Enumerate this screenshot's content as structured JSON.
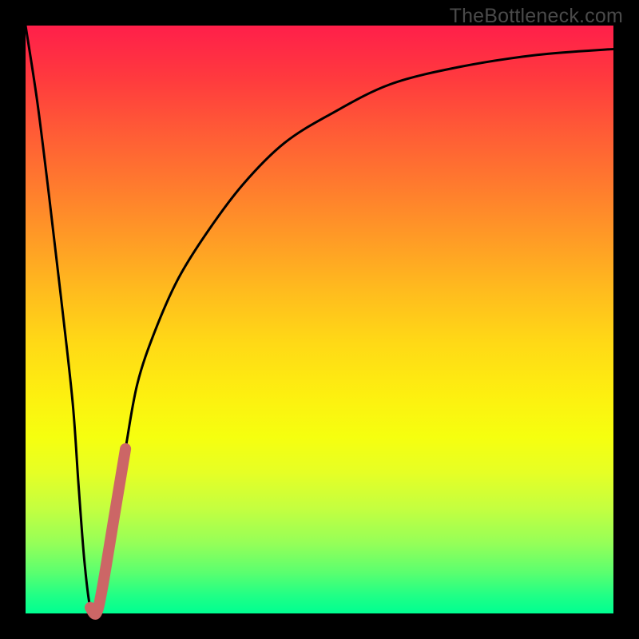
{
  "watermark": "TheBottleneck.com",
  "chart_data": {
    "type": "line",
    "title": "",
    "xlabel": "",
    "ylabel": "",
    "xlim": [
      0,
      100
    ],
    "ylim": [
      0,
      100
    ],
    "grid": false,
    "legend": false,
    "x": [
      0,
      2,
      4,
      6,
      8,
      9,
      10,
      11,
      12,
      13,
      15,
      17,
      19,
      22,
      26,
      31,
      37,
      44,
      52,
      62,
      74,
      87,
      100
    ],
    "y": [
      100,
      87,
      71,
      54,
      36,
      22,
      9,
      1,
      0,
      4,
      16,
      28,
      39,
      48,
      57,
      65,
      73,
      80,
      85,
      90,
      93,
      95,
      96
    ],
    "highlight": {
      "x": [
        11,
        12,
        13,
        15,
        17
      ],
      "y": [
        1,
        0,
        4,
        16,
        28
      ],
      "color": "#cc6666"
    }
  },
  "palette": {
    "curve": "#000000",
    "highlight": "#cc6666"
  }
}
